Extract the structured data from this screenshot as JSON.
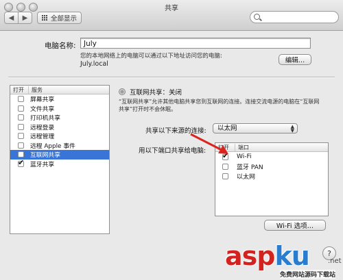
{
  "window": {
    "title": "共享"
  },
  "toolbar": {
    "back_icon": "chevron-left-icon",
    "forward_icon": "chevron-right-icon",
    "show_all_label": "全部显示",
    "search_placeholder": ""
  },
  "computer_name": {
    "label": "电脑名称:",
    "value": "July",
    "description": "您的本地网络上的电脑可以通过以下地址访问您的电脑:",
    "local_address": "July.local",
    "edit_button": "编辑…"
  },
  "services": {
    "header_on": "打开",
    "header_service": "服务",
    "items": [
      {
        "label": "屏幕共享",
        "checked": false,
        "selected": false
      },
      {
        "label": "文件共享",
        "checked": false,
        "selected": false
      },
      {
        "label": "打印机共享",
        "checked": false,
        "selected": false
      },
      {
        "label": "远程登录",
        "checked": false,
        "selected": false
      },
      {
        "label": "远程管理",
        "checked": false,
        "selected": false
      },
      {
        "label": "远程 Apple 事件",
        "checked": false,
        "selected": false
      },
      {
        "label": "互联网共享",
        "checked": false,
        "selected": true
      },
      {
        "label": "蓝牙共享",
        "checked": true,
        "selected": false
      }
    ]
  },
  "internet_sharing": {
    "status": "互联网共享：关闭",
    "info": "“互联网共享”允许其他电脑共享您到互联网的连接。连接交流电源的电脑在“互联网共享”打开时不会休眠。",
    "source_label": "共享以下来源的连接:",
    "source_value": "以太网",
    "ports_label": "用以下端口共享给电脑:",
    "ports_header_on": "打开",
    "ports_header_port": "端口",
    "ports": [
      {
        "label": "Wi-Fi",
        "checked": true
      },
      {
        "label": "蓝牙 PAN",
        "checked": false
      },
      {
        "label": "以太网",
        "checked": false
      }
    ],
    "wifi_options_button": "Wi-Fi 选项…"
  },
  "watermark": {
    "brand_a": "asp",
    "brand_b": "ku",
    "suffix": ".net",
    "sub": "免费网站源码下载站"
  },
  "colors": {
    "selection": "#3875d7",
    "arrow": "#d9251f"
  }
}
